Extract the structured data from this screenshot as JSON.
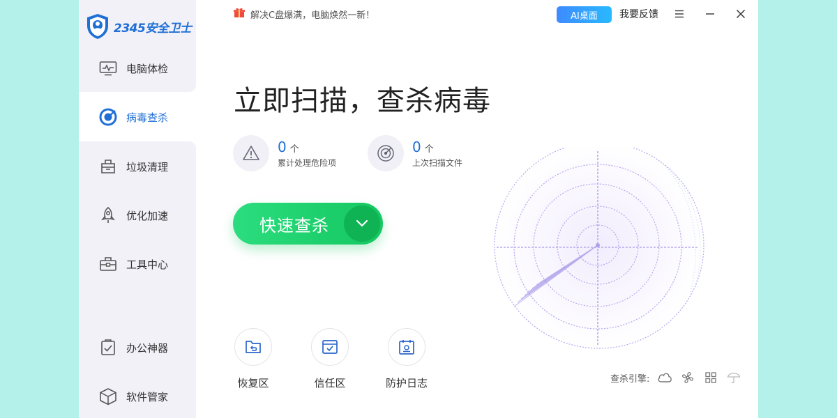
{
  "app": {
    "logo_text": "2345安全卫士"
  },
  "sidebar": {
    "items": [
      {
        "label": "电脑体检",
        "icon": "monitor-icon"
      },
      {
        "label": "病毒查杀",
        "icon": "target-icon"
      },
      {
        "label": "垃圾清理",
        "icon": "trash-bag-icon"
      },
      {
        "label": "优化加速",
        "icon": "rocket-icon"
      },
      {
        "label": "工具中心",
        "icon": "toolbox-icon"
      },
      {
        "label": "办公神器",
        "icon": "checklist-icon"
      },
      {
        "label": "软件管家",
        "icon": "box-icon"
      }
    ],
    "active_index": 1
  },
  "topbar": {
    "tip": "解决C盘爆满，电脑焕然一新！",
    "ai_button": "AI桌面",
    "feedback": "我要反馈"
  },
  "main": {
    "headline": "立即扫描，查杀病毒",
    "stats": [
      {
        "value": "0",
        "unit": "个",
        "label": "累计处理危险项",
        "icon": "warning-icon"
      },
      {
        "value": "0",
        "unit": "个",
        "label": "上次扫描文件",
        "icon": "radar-icon"
      }
    ],
    "scan_button": "快速查杀",
    "tools": [
      {
        "label": "恢复区",
        "icon": "folder-restore-icon"
      },
      {
        "label": "信任区",
        "icon": "trusted-box-icon"
      },
      {
        "label": "防护日志",
        "icon": "log-calendar-icon"
      }
    ],
    "engine_label": "查杀引擎:"
  },
  "colors": {
    "accent": "#1f6fd6",
    "green": "#1fd06f",
    "background": "#b3f1ea"
  }
}
